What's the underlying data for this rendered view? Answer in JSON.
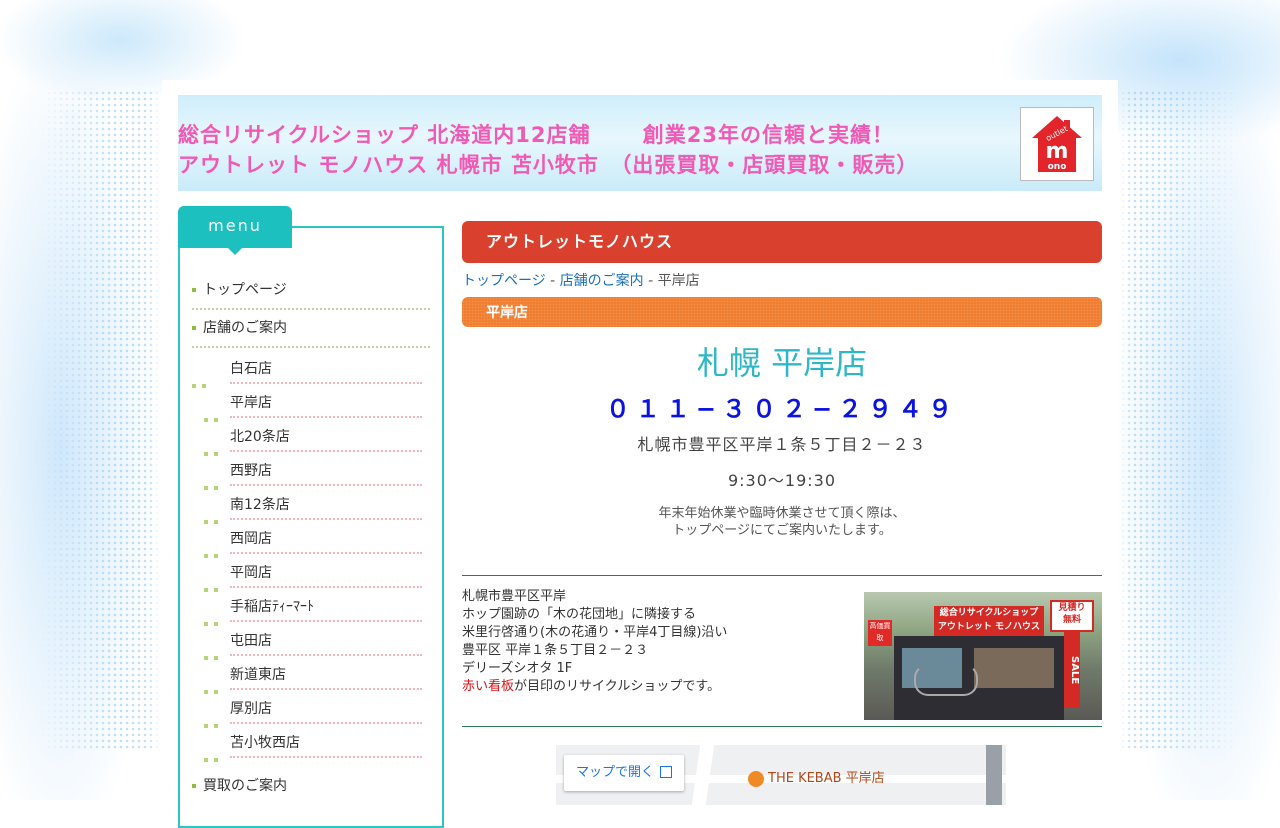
{
  "banner": {
    "line1": "総合リサイクルショップ 北海道内12店舗　　 創業23年の信頼と実績！",
    "line2": "アウトレット モノハウス 札幌市 苫小牧市　（出張買取・店頭買取・販売）",
    "logo_top": "outlet",
    "logo_letter": "m",
    "logo_bottom": "ono"
  },
  "sidebar": {
    "menu_label": "menu",
    "top_items": [
      "トップページ",
      "店舗のご案内"
    ],
    "store_items": [
      "白石店",
      "平岸店",
      "北20条店",
      "西野店",
      "南12条店",
      "西岡店",
      "平岡店",
      "手稲店ﾃｨｰﾏｰﾄ",
      "屯田店",
      "新道東店",
      "厚別店",
      "苫小牧西店"
    ],
    "bottom_item": "買取のご案内"
  },
  "main": {
    "header": "アウトレットモノハウス",
    "breadcrumb": {
      "home": "トップページ",
      "stores": "店舗のご案内",
      "separator": " - ",
      "current": "平岸店"
    },
    "sub_header": "平岸店",
    "store_title": "札幌 平岸店",
    "phone": "０１１−３０２−２９４９",
    "address": "札幌市豊平区平岸１条５丁目２－２３",
    "hours": "9:30〜19:30",
    "note_line1": "年末年始休業や臨時休業させて頂く際は、",
    "note_line2": "トップページにてご案内いたします。",
    "info": {
      "line1": "札幌市豊平区平岸",
      "line2": "ホップ園跡の「木の花団地」に隣接する",
      "line3": "米里行啓通り(木の花通り・平岸4丁目線)沿い",
      "line4": "豊平区 平岸１条５丁目２－２３",
      "line5": "デリーズシオタ 1F",
      "line6_red": "赤い看板",
      "line6_rest": "が目印のリサイクルショップです。"
    },
    "photo": {
      "sign_main_line1": "総合リサイクルショップ",
      "sign_main_line2": "アウトレット モノハウス",
      "sign_left": "高価買取",
      "sign_right_line1": "見積り",
      "sign_right_line2": "無料",
      "banner_right": "SALE"
    },
    "map": {
      "open_button": "マップで開く",
      "poi": "THE KEBAB 平岸店"
    }
  },
  "colors": {
    "accent_teal": "#1cc0be",
    "header_red": "#d9412e",
    "subheader_orange": "#f07a2a",
    "banner_pink": "#f05ab4",
    "phone_blue": "#0b13e0",
    "title_teal": "#2fb7c8"
  }
}
